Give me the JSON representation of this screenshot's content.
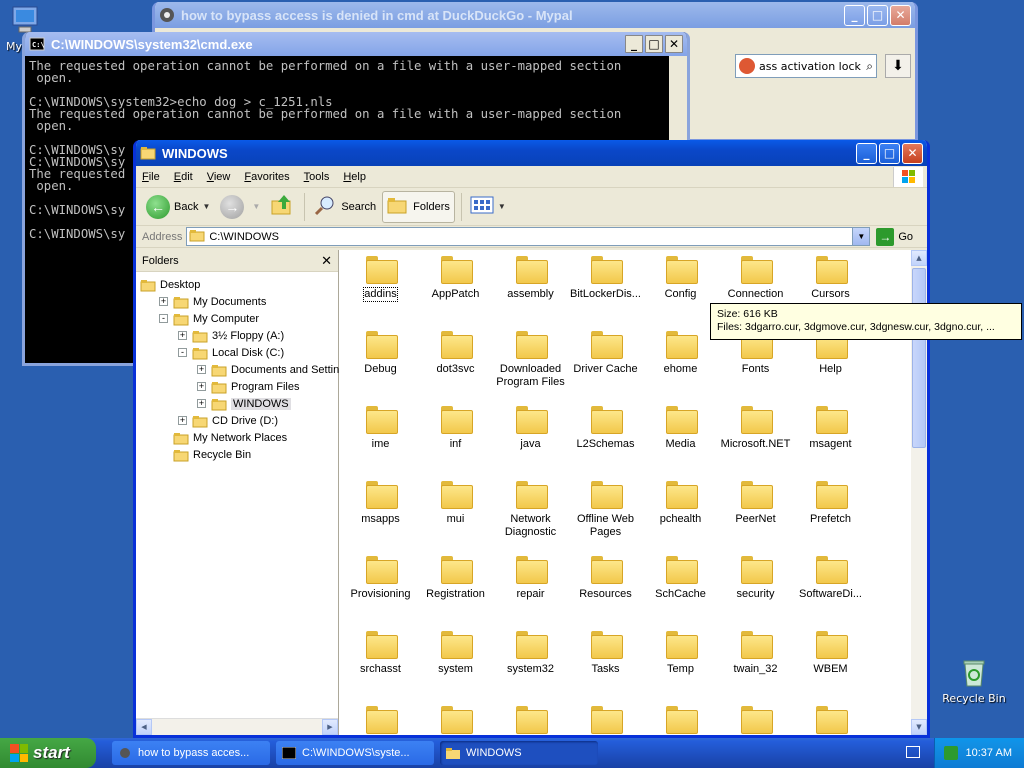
{
  "desktop": {
    "my_computer_label": "My",
    "recycle_bin_label": "Recycle Bin"
  },
  "browser": {
    "title": "how to bypass access is denied in cmd at DuckDuckGo - Mypal",
    "search_value": "ass activation lock"
  },
  "cmd": {
    "title": "C:\\WINDOWS\\system32\\cmd.exe",
    "lines": [
      "The requested operation cannot be performed on a file with a user-mapped section",
      " open.",
      "",
      "C:\\WINDOWS\\system32>echo dog > c_1251.nls",
      "The requested operation cannot be performed on a file with a user-mapped section",
      " open.",
      "",
      "C:\\WINDOWS\\sy",
      "C:\\WINDOWS\\sy",
      "The requested",
      " open.",
      "",
      "C:\\WINDOWS\\sy",
      "",
      "C:\\WINDOWS\\sy"
    ]
  },
  "explorer": {
    "title": "WINDOWS",
    "menu": [
      "File",
      "Edit",
      "View",
      "Favorites",
      "Tools",
      "Help"
    ],
    "toolbar": {
      "back": "Back",
      "search": "Search",
      "folders": "Folders"
    },
    "address_label": "Address",
    "address_value": "C:\\WINDOWS",
    "go_label": "Go",
    "folders_pane_title": "Folders",
    "tree": [
      {
        "label": "Desktop",
        "level": 0,
        "expander": ""
      },
      {
        "label": "My Documents",
        "level": 1,
        "expander": "+"
      },
      {
        "label": "My Computer",
        "level": 1,
        "expander": "-"
      },
      {
        "label": "3½ Floppy (A:)",
        "level": 2,
        "expander": "+"
      },
      {
        "label": "Local Disk (C:)",
        "level": 2,
        "expander": "-"
      },
      {
        "label": "Documents and Settings",
        "level": 3,
        "expander": "+"
      },
      {
        "label": "Program Files",
        "level": 3,
        "expander": "+"
      },
      {
        "label": "WINDOWS",
        "level": 3,
        "expander": "+",
        "selected": true
      },
      {
        "label": "CD Drive (D:)",
        "level": 2,
        "expander": "+"
      },
      {
        "label": "My Network Places",
        "level": 1,
        "expander": ""
      },
      {
        "label": "Recycle Bin",
        "level": 1,
        "expander": ""
      }
    ],
    "items": [
      "addins",
      "AppPatch",
      "assembly",
      "BitLockerDis...",
      "Config",
      "Connection",
      "Cursors",
      "Debug",
      "dot3svc",
      "Downloaded Program Files",
      "Driver Cache",
      "ehome",
      "Fonts",
      "Help",
      "ime",
      "inf",
      "java",
      "L2Schemas",
      "Media",
      "Microsoft.NET",
      "msagent",
      "msapps",
      "mui",
      "Network Diagnostic",
      "Offline Web Pages",
      "pchealth",
      "PeerNet",
      "Prefetch",
      "Provisioning",
      "Registration",
      "repair",
      "Resources",
      "SchCache",
      "security",
      "SoftwareDi...",
      "srchasst",
      "system",
      "system32",
      "Tasks",
      "Temp",
      "twain_32",
      "WBEM",
      "",
      "",
      "",
      "",
      "",
      "",
      ""
    ],
    "tooltip": {
      "line1": "Size: 616 KB",
      "line2": "Files: 3dgarro.cur, 3dgmove.cur, 3dgnesw.cur, 3dgno.cur, ..."
    }
  },
  "taskbar": {
    "start_label": "start",
    "tasks": [
      {
        "label": "how to bypass acces...",
        "active": false
      },
      {
        "label": "C:\\WINDOWS\\syste...",
        "active": false
      },
      {
        "label": "WINDOWS",
        "active": true
      }
    ],
    "clock": "10:37 AM"
  }
}
